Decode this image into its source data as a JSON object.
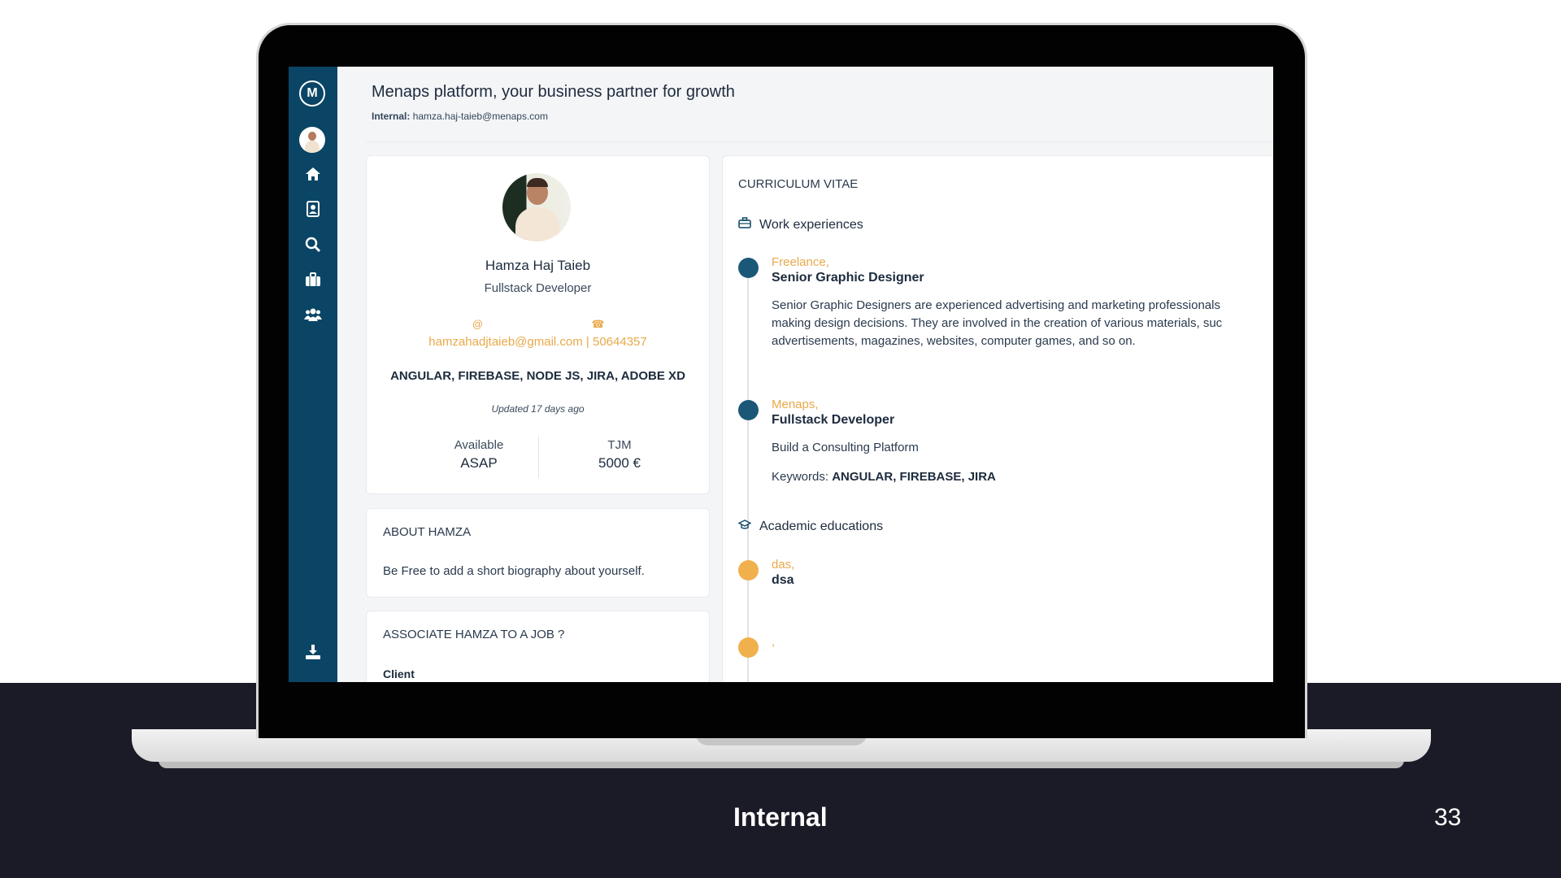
{
  "slide": {
    "footer_label": "Internal",
    "page_number": "33"
  },
  "app": {
    "title": "Menaps platform, your business partner for growth",
    "internal_label": "Internal:",
    "internal_email": "hamza.haj-taieb@menaps.com",
    "logo_text": "M"
  },
  "sidebar": {
    "icons": [
      "menaps-logo-icon",
      "user-avatar-icon",
      "home-icon",
      "contacts-icon",
      "search-icon",
      "briefcase-icon",
      "users-icon",
      "download-icon"
    ]
  },
  "profile": {
    "name": "Hamza Haj Taieb",
    "role": "Fullstack Developer",
    "email_icon": "@",
    "phone_icon": "☎",
    "contact": "hamzahadjtaieb@gmail.com | 50644357",
    "skills": "ANGULAR, FIREBASE, NODE JS, JIRA, ADOBE XD",
    "updated": "Updated 17 days ago",
    "available_label": "Available",
    "available_value": "ASAP",
    "tjm_label": "TJM",
    "tjm_value": "5000 €"
  },
  "about": {
    "title": "ABOUT HAMZA",
    "text": "Be Free to add a short biography about yourself."
  },
  "associate": {
    "title": "ASSOCIATE HAMZA TO A JOB ?",
    "client_label": "Client"
  },
  "cv": {
    "title": "CURRICULUM VITAE",
    "work_heading": "Work experiences",
    "education_heading": "Academic educations",
    "work": [
      {
        "company": "Freelance,",
        "position": "Senior Graphic Designer",
        "desc_line1": "Senior Graphic Designers are experienced advertising and marketing professionals",
        "desc_line2": "making design decisions. They are involved in the creation of various materials, suc",
        "desc_line3": "advertisements, magazines, websites, computer games, and so on."
      },
      {
        "company": "Menaps,",
        "position": "Fullstack Developer",
        "description": "Build a Consulting Platform",
        "keywords_label": "Keywords:",
        "keywords": "ANGULAR, FIREBASE, JIRA"
      }
    ],
    "education": [
      {
        "school": "das,",
        "degree": "dsa"
      },
      {
        "school": ","
      }
    ]
  },
  "colors": {
    "sidebar": "#0a4565",
    "accent_orange": "#e9a94a",
    "dot_blue": "#1b5878",
    "dot_orange": "#f0b04c",
    "slide_dark": "#1b1b27"
  }
}
